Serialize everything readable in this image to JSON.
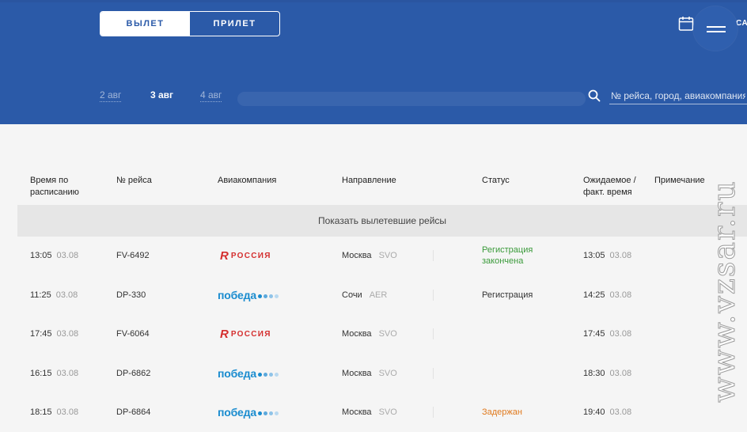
{
  "header": {
    "tabs": [
      {
        "label": "ВЫЛЕТ",
        "active": true
      },
      {
        "label": "ПРИЛЕТ",
        "active": false
      }
    ],
    "cut_text": "СА",
    "dates": [
      {
        "label": "2 авг",
        "active": false
      },
      {
        "label": "3 авг",
        "active": true
      },
      {
        "label": "4 авг",
        "active": false
      }
    ],
    "search": {
      "placeholder": "№ рейса, город, авиакомпания"
    },
    "icons": {
      "calendar": "calendar-icon",
      "menu": "hamburger-menu-icon",
      "search": "search-icon"
    }
  },
  "table": {
    "columns": [
      "Время по расписанию",
      "№ рейса",
      "Авиакомпания",
      "Направление",
      "Статус",
      "Ожидаемое / факт. время",
      "Примечание"
    ],
    "show_departed_label": "Показать вылетевшие рейсы",
    "rows": [
      {
        "time": "13:05",
        "date": "03.08",
        "flight": "FV-6492",
        "airline": "rossiya",
        "city": "Москва",
        "code": "SVO",
        "status": "Регистрация закончена",
        "status_type": "green",
        "eta_time": "13:05",
        "eta_date": "03.08"
      },
      {
        "time": "11:25",
        "date": "03.08",
        "flight": "DP-330",
        "airline": "pobeda",
        "city": "Сочи",
        "code": "AER",
        "status": "Регистрация",
        "status_type": "normal",
        "eta_time": "14:25",
        "eta_date": "03.08"
      },
      {
        "time": "17:45",
        "date": "03.08",
        "flight": "FV-6064",
        "airline": "rossiya",
        "city": "Москва",
        "code": "SVO",
        "status": "",
        "status_type": "normal",
        "eta_time": "17:45",
        "eta_date": "03.08"
      },
      {
        "time": "16:15",
        "date": "03.08",
        "flight": "DP-6862",
        "airline": "pobeda",
        "city": "Москва",
        "code": "SVO",
        "status": "",
        "status_type": "normal",
        "eta_time": "18:30",
        "eta_date": "03.08"
      },
      {
        "time": "18:15",
        "date": "03.08",
        "flight": "DP-6864",
        "airline": "pobeda",
        "city": "Москва",
        "code": "SVO",
        "status": "Задержан",
        "status_type": "orange",
        "eta_time": "19:40",
        "eta_date": "03.08"
      }
    ]
  },
  "airlines": {
    "rossiya": {
      "mark": "R",
      "text": "РОССИЯ",
      "color": "#d42e2e"
    },
    "pobeda": {
      "text": "победа",
      "color": "#1a8ccf",
      "dot_colors": [
        "#1a8ccf",
        "#5aa8dc",
        "#8fc3e8",
        "#b9d9f0"
      ]
    }
  },
  "colors": {
    "header_bg": "#2b5aa8",
    "status_green": "#3a9a3a",
    "status_orange": "#e07a1e"
  },
  "watermark": {
    "text": "www.vzsar.ru"
  }
}
